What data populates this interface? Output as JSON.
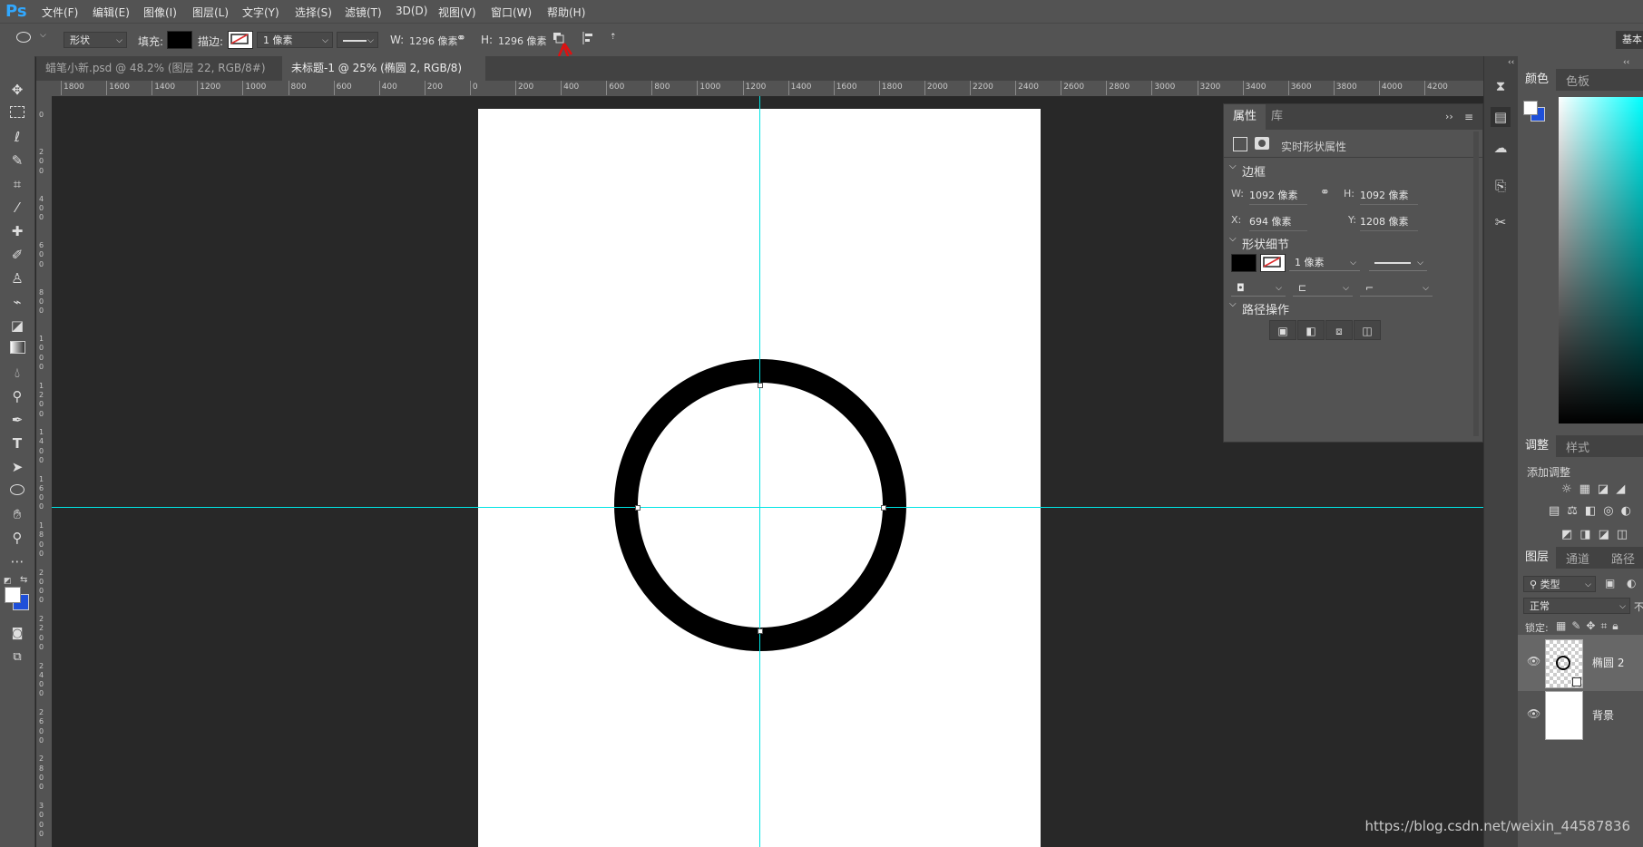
{
  "app": {
    "logo": "Ps"
  },
  "menubar": {
    "items": [
      "文件(F)",
      "编辑(E)",
      "图像(I)",
      "图层(L)",
      "文字(Y)",
      "选择(S)",
      "滤镜(T)",
      "3D(D)",
      "视图(V)",
      "窗口(W)",
      "帮助(H)"
    ]
  },
  "options": {
    "mode": "形状",
    "fill_label": "填充:",
    "stroke_label": "描边:",
    "stroke_width": "1 像素",
    "w_label": "W:",
    "w_value": "1296 像素",
    "h_label": "H:",
    "h_value": "1296 像素",
    "workspace": "基本"
  },
  "tabs": [
    {
      "label": "蜡笔小新.psd @ 48.2% (图层 22, RGB/8#) *",
      "close": "×",
      "active": false
    },
    {
      "label": "未标题-1 @ 25% (椭圆 2, RGB/8) *",
      "close": "×",
      "active": true
    }
  ],
  "ruler": {
    "h_ticks": [
      "1800",
      "1600",
      "1400",
      "1200",
      "1000",
      "800",
      "600",
      "400",
      "200",
      "0",
      "200",
      "400",
      "600",
      "800",
      "1000",
      "1200",
      "1400",
      "1600",
      "1800",
      "2000",
      "2200",
      "2400",
      "2600",
      "2800",
      "3000",
      "3200",
      "3400",
      "3600",
      "3800",
      "4000",
      "4200"
    ]
  },
  "properties": {
    "tabs": [
      "属性",
      "库"
    ],
    "header": "实时形状属性",
    "bounds_section": "边框",
    "w_label": "W:",
    "w_value": "1092 像素",
    "h_label": "H:",
    "h_value": "1092 像素",
    "x_label": "X:",
    "x_value": "694 像素",
    "y_label": "Y:",
    "y_value": "1208 像素",
    "shape_section": "形状细节",
    "stroke_width": "1 像素",
    "path_ops_section": "路径操作"
  },
  "right": {
    "color_tabs": [
      "颜色",
      "色板"
    ],
    "adjust_tabs": [
      "调整",
      "样式"
    ],
    "add_adjustment": "添加调整",
    "layer_tabs": [
      "图层",
      "通道",
      "路径"
    ],
    "kind_filter": "类型",
    "blend_mode": "正常",
    "lock_label": "锁定:",
    "layers": [
      {
        "name": "椭圆 2"
      },
      {
        "name": "背景"
      }
    ]
  },
  "watermark": "https://blog.csdn.net/weixin_44587836",
  "colors": {
    "guide": "#00e5e5",
    "accent": "#31a8ff",
    "bg_swatch": "#1e4fd8"
  }
}
